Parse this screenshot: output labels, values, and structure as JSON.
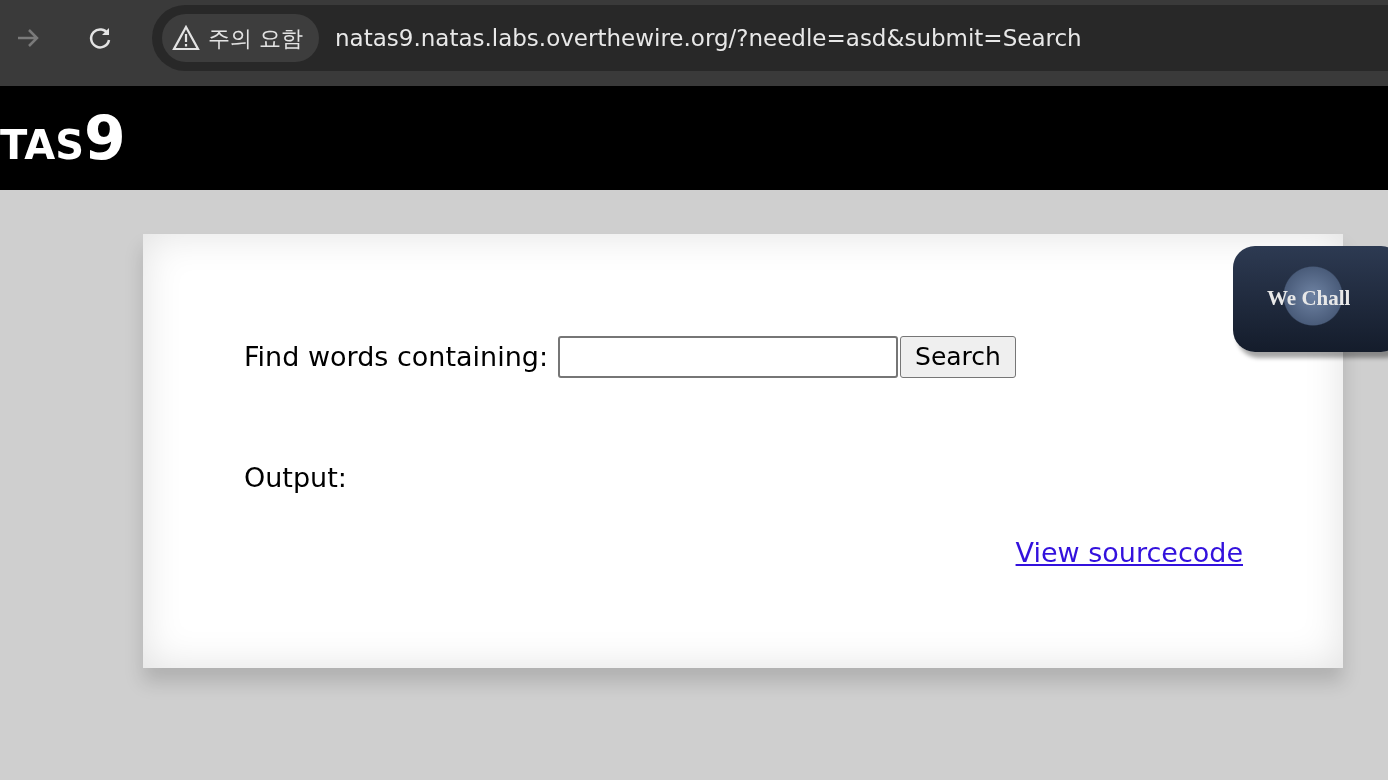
{
  "browser": {
    "forward_disabled": true,
    "security_chip": "주의 요함",
    "url": "natas9.natas.labs.overthewire.org/?needle=asd&submit=Search"
  },
  "header": {
    "title": "TAS",
    "number": "9"
  },
  "form": {
    "label": "Find words containing:",
    "button": "Search"
  },
  "output": {
    "label": "Output:"
  },
  "link": "View sourcecode",
  "badge": {
    "text": "We Chall"
  }
}
